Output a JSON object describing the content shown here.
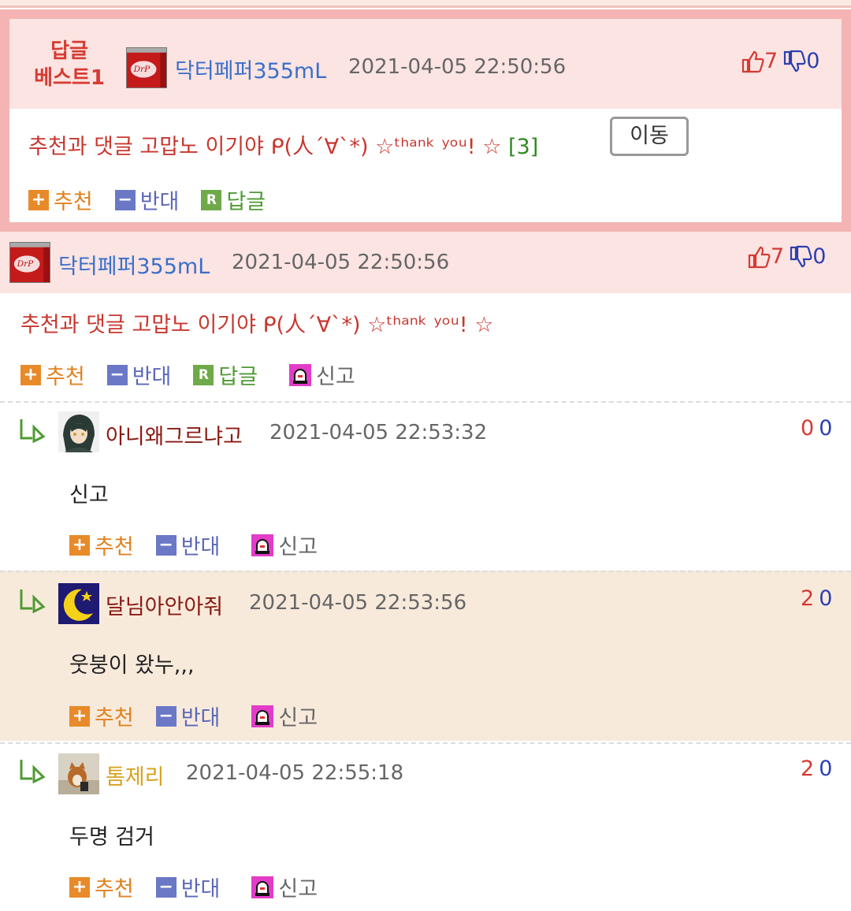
{
  "best": {
    "label_line1": "답글",
    "label_line2": "베스트1",
    "nickname": "닥터페퍼355mL",
    "datetime": "2021-04-05 22:50:56",
    "up": "7",
    "down": "0",
    "message": "추천과 댓글 고맙노 이기야 ᑭ(人´∀`*) ☆ᵗʰᵃⁿᵏ ʸᵒᵘ! ☆",
    "reply_count": "[3]",
    "move_label": "이동",
    "actions": {
      "recommend": "추천",
      "oppose": "반대",
      "reply": "답글"
    }
  },
  "original": {
    "nickname": "닥터페퍼355mL",
    "datetime": "2021-04-05 22:50:56",
    "up": "7",
    "down": "0",
    "message": "추천과 댓글 고맙노 이기야 ᑭ(人´∀`*) ☆ᵗʰᵃⁿᵏ ʸᵒᵘ! ☆",
    "actions": {
      "recommend": "추천",
      "oppose": "반대",
      "reply": "답글",
      "report": "신고"
    }
  },
  "replies": [
    {
      "nickname": "아니왜그르냐고",
      "datetime": "2021-04-05 22:53:32",
      "up": "0",
      "down": "0",
      "text": "신고",
      "actions": {
        "recommend": "추천",
        "oppose": "반대",
        "report": "신고"
      }
    },
    {
      "nickname": "달님아안아줘",
      "datetime": "2021-04-05 22:53:56",
      "up": "2",
      "down": "0",
      "text": "웃붕이 왔누,,,",
      "actions": {
        "recommend": "추천",
        "oppose": "반대",
        "report": "신고"
      }
    },
    {
      "nickname": "톰제리",
      "datetime": "2021-04-05 22:55:18",
      "up": "2",
      "down": "0",
      "text": "두명 검거",
      "actions": {
        "recommend": "추천",
        "oppose": "반대",
        "report": "신고"
      }
    }
  ],
  "colors": {
    "best_border": "#f4b4b3",
    "header_bg": "#fbe4e2",
    "highlight_bg": "#f8eadb",
    "nick_blue": "#3a6fc9",
    "nick_red": "#8b1a12",
    "nick_yellow": "#d9a21f"
  },
  "icons": [
    "thumbs-up-icon",
    "thumbs-down-icon",
    "plus-icon",
    "minus-icon",
    "reply-icon",
    "siren-icon",
    "reply-arrow-icon"
  ]
}
